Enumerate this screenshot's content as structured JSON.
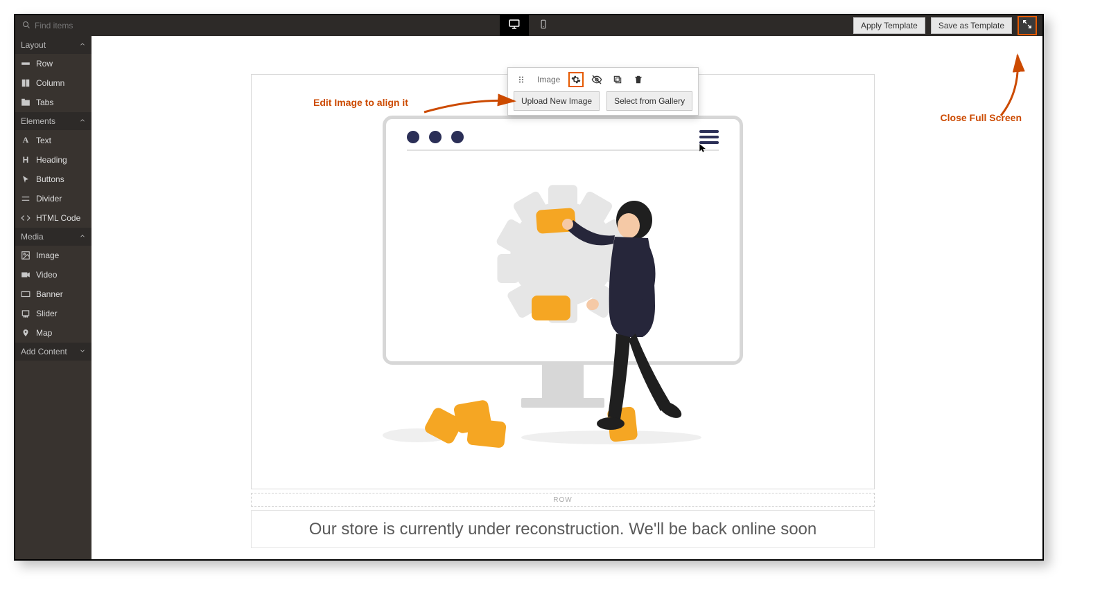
{
  "topbar": {
    "search_placeholder": "Find items",
    "apply_template": "Apply Template",
    "save_as_template": "Save as Template"
  },
  "sidebar": {
    "layout_header": "Layout",
    "layout_items": [
      "Row",
      "Column",
      "Tabs"
    ],
    "elements_header": "Elements",
    "elements_items": [
      "Text",
      "Heading",
      "Buttons",
      "Divider",
      "HTML Code"
    ],
    "media_header": "Media",
    "media_items": [
      "Image",
      "Video",
      "Banner",
      "Slider",
      "Map"
    ],
    "add_content": "Add Content"
  },
  "image_toolbar": {
    "label": "Image",
    "upload": "Upload New Image",
    "gallery": "Select from Gallery"
  },
  "row_label": "ROW",
  "page_text": "Our store is currently under reconstruction. We'll be back online soon",
  "annotations": {
    "edit_image": "Edit Image to align it",
    "close_fullscreen": "Close Full Screen"
  }
}
